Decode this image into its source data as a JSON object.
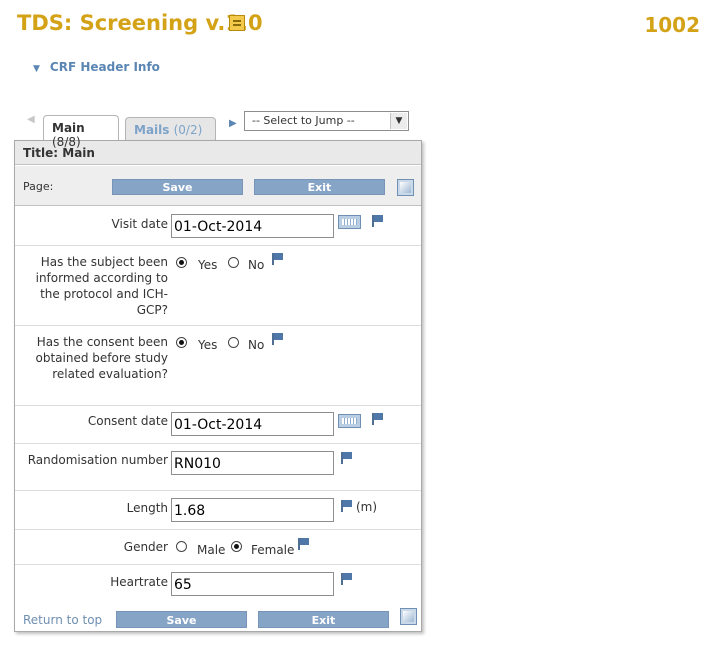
{
  "header": {
    "title": "TDS: Screening v.1.0",
    "record_id": "1002",
    "crf_header_toggle": "CRF Header Info"
  },
  "tabs": [
    {
      "label": "Main",
      "count": "(8/8)",
      "active": true
    },
    {
      "label": "Mails",
      "count": "(0/2)",
      "active": false
    }
  ],
  "jump": {
    "selected": "-- Select to Jump --"
  },
  "panel": {
    "title": "Title: Main",
    "page_label": "Page:",
    "save_label": "Save",
    "exit_label": "Exit",
    "return_to_top": "Return to top"
  },
  "fields": {
    "visit_date": {
      "label": "Visit date",
      "value": "01-Oct-2014"
    },
    "informed": {
      "label": "Has the subject been informed according to the protocol and ICH-GCP?",
      "yes": "Yes",
      "no": "No",
      "selected": "Yes"
    },
    "consent_obtained": {
      "label": "Has the consent been obtained before study related evaluation?",
      "yes": "Yes",
      "no": "No",
      "selected": "Yes"
    },
    "consent_date": {
      "label": "Consent date",
      "value": "01-Oct-2014"
    },
    "randomisation": {
      "label": "Randomisation number",
      "value": "RN010"
    },
    "length": {
      "label": "Length",
      "value": "1.68",
      "unit": "(m)"
    },
    "gender": {
      "label": "Gender",
      "male": "Male",
      "female": "Female",
      "selected": "Female"
    },
    "heartrate": {
      "label": "Heartrate",
      "value": "65"
    }
  },
  "colors": {
    "title": "#d4a216",
    "accent": "#86a4c6",
    "link": "#6f8fb3"
  }
}
